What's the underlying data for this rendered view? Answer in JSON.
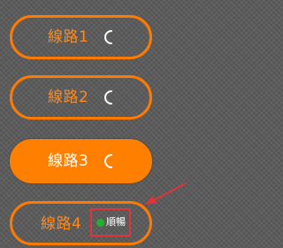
{
  "routes": [
    {
      "label": "線路1",
      "state": "loading",
      "icon": "loading-spinner-icon"
    },
    {
      "label": "線路2",
      "state": "loading",
      "icon": "loading-spinner-icon"
    },
    {
      "label": "線路3",
      "state": "loading",
      "icon": "loading-spinner-icon",
      "selected": true
    },
    {
      "label": "線路4",
      "status": "順暢",
      "status_icon": "green-status-dot"
    }
  ],
  "colors": {
    "accent": "#ff7f00",
    "status_ok": "#22b02a",
    "highlight": "#e0333a",
    "background": "#5a5a5a"
  }
}
